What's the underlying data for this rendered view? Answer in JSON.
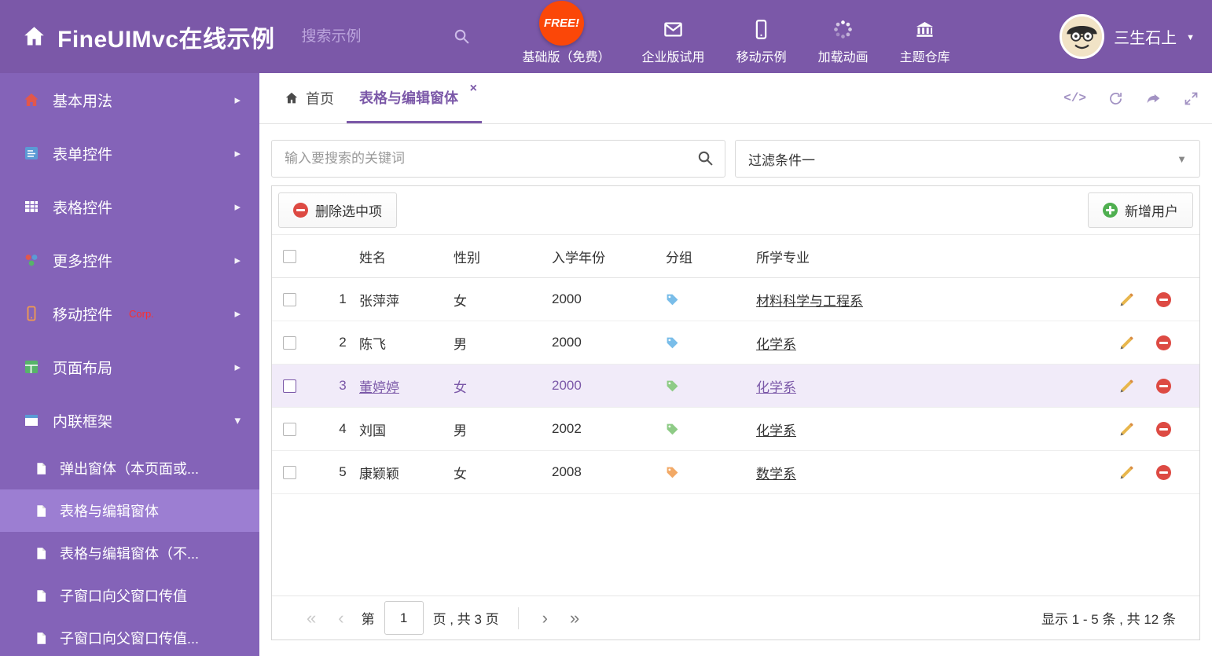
{
  "header": {
    "title": "FineUIMvc在线示例",
    "search_placeholder": "搜索示例",
    "free_badge": "FREE!",
    "nav": [
      {
        "label": "基础版（免费）"
      },
      {
        "label": "企业版试用"
      },
      {
        "label": "移动示例"
      },
      {
        "label": "加载动画"
      },
      {
        "label": "主题仓库"
      }
    ],
    "user_name": "三生石上"
  },
  "sidebar": {
    "items": [
      {
        "label": "基本用法"
      },
      {
        "label": "表单控件"
      },
      {
        "label": "表格控件"
      },
      {
        "label": "更多控件"
      },
      {
        "label": "移动控件",
        "badge": "Corp."
      },
      {
        "label": "页面布局"
      },
      {
        "label": "内联框架"
      }
    ],
    "subitems": [
      {
        "label": "弹出窗体（本页面或..."
      },
      {
        "label": "表格与编辑窗体"
      },
      {
        "label": "表格与编辑窗体（不..."
      },
      {
        "label": "子窗口向父窗口传值"
      },
      {
        "label": "子窗口向父窗口传值..."
      }
    ]
  },
  "tabs": [
    {
      "label": "首页"
    },
    {
      "label": "表格与编辑窗体"
    }
  ],
  "filter": {
    "search_placeholder": "输入要搜索的关键词",
    "dropdown_value": "过滤条件一"
  },
  "toolbar": {
    "delete_label": "删除选中项",
    "add_label": "新增用户"
  },
  "table": {
    "columns": [
      "姓名",
      "性别",
      "入学年份",
      "分组",
      "所学专业"
    ],
    "rows": [
      {
        "index": "1",
        "name": "张萍萍",
        "gender": "女",
        "year": "2000",
        "tag_color": "#79bde9",
        "major": "材料科学与工程系"
      },
      {
        "index": "2",
        "name": "陈飞",
        "gender": "男",
        "year": "2000",
        "tag_color": "#79bde9",
        "major": "化学系"
      },
      {
        "index": "3",
        "name": "董婷婷",
        "gender": "女",
        "year": "2000",
        "tag_color": "#8ecb86",
        "major": "化学系"
      },
      {
        "index": "4",
        "name": "刘国",
        "gender": "男",
        "year": "2002",
        "tag_color": "#8ecb86",
        "major": "化学系"
      },
      {
        "index": "5",
        "name": "康颖颖",
        "gender": "女",
        "year": "2008",
        "tag_color": "#f2a966",
        "major": "数学系"
      }
    ]
  },
  "pagination": {
    "label_page": "第",
    "page_value": "1",
    "label_total": "页 , 共 3 页",
    "summary": "显示 1 - 5 条 , 共 12 条"
  },
  "icons": {
    "chevron_right": "▸",
    "chevron_down": "▾",
    "caret_down": "▼",
    "close": "×",
    "code": "</>",
    "pg_first": "«",
    "pg_prev": "‹",
    "pg_next": "›",
    "pg_last": "»"
  },
  "colors": {
    "header_bg": "#7b58a8",
    "sidebar_bg": "#8463b8",
    "accent": "#7b58a8",
    "free_badge_bg": "#fb4708",
    "delete_red": "#dd4a43",
    "add_green": "#4faf50"
  }
}
